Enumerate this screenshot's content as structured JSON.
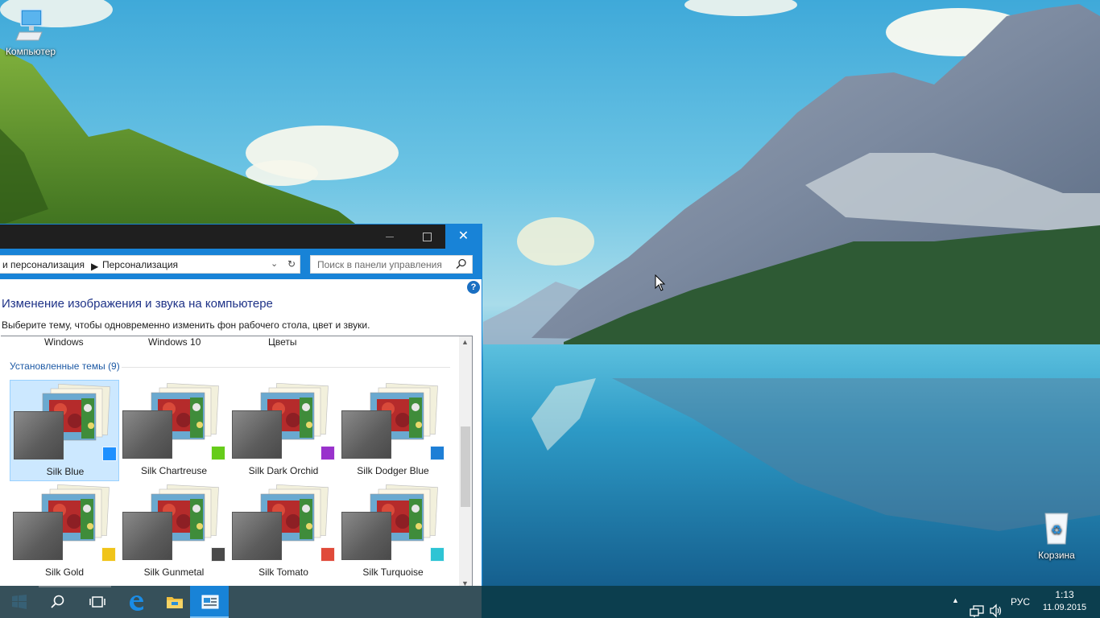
{
  "desktop": {
    "icons": [
      {
        "label": "Компьютер",
        "icon": "computer-icon"
      },
      {
        "label": "Корзина",
        "icon": "recycle-bin-icon"
      }
    ]
  },
  "window": {
    "breadcrumb": {
      "items": [
        "и персонализация",
        "Персонализация"
      ],
      "separator_icon": "chevron-right-icon"
    },
    "search": {
      "placeholder": "Поиск в панели управления",
      "icon": "search-icon"
    },
    "help_icon": "help-icon",
    "help_label": "?",
    "title": "Изменение изображения и звука на компьютере",
    "subtitle": "Выберите тему, чтобы одновременно изменить фон рабочего стола, цвет и звуки.",
    "column_headers": [
      "Windows",
      "Windows 10",
      "Цветы"
    ],
    "group_label": "Установленные темы (9)",
    "themes": [
      {
        "name": "Silk Blue",
        "color": "#1e90ff",
        "selected": true
      },
      {
        "name": "Silk Chartreuse",
        "color": "#66cc1a",
        "selected": false
      },
      {
        "name": "Silk Dark Orchid",
        "color": "#9932cc",
        "selected": false
      },
      {
        "name": "Silk Dodger Blue",
        "color": "#1e7fd6",
        "selected": false
      },
      {
        "name": "Silk Gold",
        "color": "#f0c419",
        "selected": false
      },
      {
        "name": "Silk Gunmetal",
        "color": "#4a4a4a",
        "selected": false
      },
      {
        "name": "Silk Tomato",
        "color": "#e04a3a",
        "selected": false
      },
      {
        "name": "Silk Turquoise",
        "color": "#2ec4d4",
        "selected": false
      }
    ]
  },
  "taskbar": {
    "items": [
      "start-icon",
      "search-icon",
      "task-view-icon",
      "edge-icon",
      "file-explorer-icon",
      "control-panel-icon"
    ],
    "tray": {
      "language": "РУС",
      "time": "1:13",
      "date": "11.09.2015"
    }
  },
  "colors": {
    "accent": "#1883d7",
    "titlebar": "#1f1f1f",
    "taskbar": "#0c3e4e",
    "selection": "#cce8ff"
  }
}
